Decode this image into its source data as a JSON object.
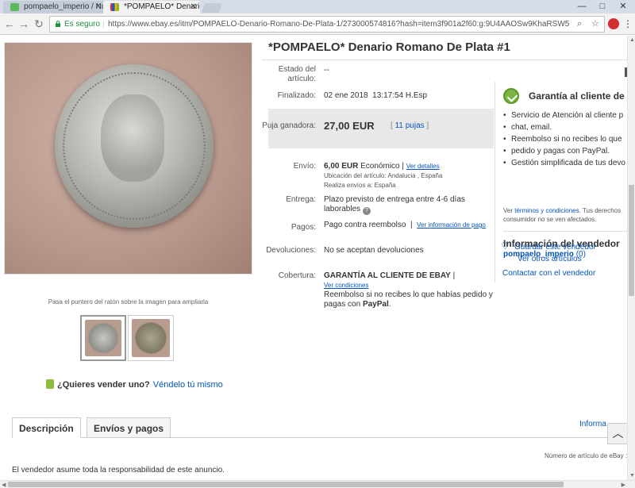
{
  "browser": {
    "tabs": [
      {
        "title": "pompaelo_imperio / Nu",
        "active": false,
        "favicon_color": "#5cb85c"
      },
      {
        "title": "*POMPAELO* Denario R",
        "active": true,
        "favicon_color": "#e53238"
      }
    ],
    "secure_label": "Es seguro",
    "url": "https://www.ebay.es/itm/POMPAELO-Denario-Romano-De-Plata-1/273000574816?hash=item3f901a2f60:g:9U4AAOSw9KhaRSW5",
    "window_controls": [
      "—",
      "□",
      "✕"
    ]
  },
  "listing": {
    "title": "*POMPAELO* Denario Romano De Plata #1",
    "condition_label": "Estado del artículo:",
    "condition_value": "--",
    "ended_label": "Finalizado:",
    "ended_value": "02 ene 2018  13:17:54 H.Esp",
    "winning_bid_label": "Puja ganadora:",
    "winning_bid_value": "27,00 EUR",
    "bids_link": "11 pujas",
    "shipping_label": "Envío:",
    "shipping_price": "6,00 EUR",
    "shipping_type": "Económico |",
    "shipping_details_link": "Ver detalles",
    "item_location": "Ubicación del artículo:  Andalucia , España",
    "ships_to": "Realiza envíos a:  España",
    "delivery_label": "Entrega:",
    "delivery_value": "Plazo previsto de entrega entre 4-6 días laborables",
    "payments_label": "Pagos:",
    "payments_value": "Pago contra reembolso",
    "payments_link": "Ver información de pago",
    "returns_label": "Devoluciones:",
    "returns_value": "No se aceptan devoluciones",
    "coverage_label": "Cobertura:",
    "coverage_title": "GARANTÍA AL CLIENTE DE EBAY",
    "coverage_link": "Ver condiciones",
    "coverage_text": "Reembolso si no recibes lo que habías pedido y pagas con",
    "paypal": "PayPal"
  },
  "image": {
    "caption": "Pasa el puntero del ratón sobre la imagen para ampliarla"
  },
  "sell": {
    "question": "¿Quieres vender uno?",
    "link": "Véndelo tú mismo"
  },
  "guarantee": {
    "title": "Garantía al cliente de",
    "items": [
      "Servicio de Atención al cliente p",
      "chat, email.",
      "Reembolso si no recibes lo que",
      "pedido y pagas con PayPal.",
      "Gestión simplificada de tus devo"
    ],
    "note_prefix": "Ver",
    "note_link": "términos y condiciones",
    "note_suffix": ". Tus derechos consumidor no se ven afectados."
  },
  "seller": {
    "heading": "Información del vendedor",
    "name": "pompaelo_imperio",
    "feedback": "(0)",
    "save_seller": "Guardar este vendedor",
    "other_items": "Ver otros artículos",
    "contact": "Contactar con el vendedor"
  },
  "bottom": {
    "tab_description": "Descripción",
    "tab_shipping": "Envíos y pagos",
    "info_link": "Informa",
    "item_number_label": "Número de artículo de eBay :",
    "disclaimer": "El vendedor asume toda la responsabilidad de este anuncio."
  }
}
